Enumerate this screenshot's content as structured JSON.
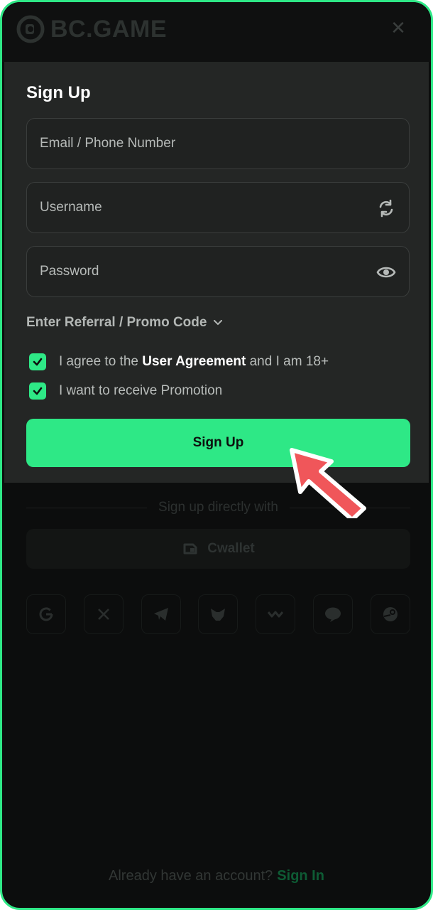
{
  "brand": {
    "name": "BC.GAME",
    "accent": "#2ee886"
  },
  "header": {
    "close_icon": "close-icon"
  },
  "form": {
    "title": "Sign Up",
    "email_placeholder": "Email / Phone Number",
    "username_placeholder": "Username",
    "password_placeholder": "Password",
    "promo_label": "Enter Referral / Promo Code",
    "agree_prefix": "I agree to the ",
    "agree_link": "User Agreement",
    "agree_suffix": " and I am 18+",
    "promo_opt_in": "I want to receive Promotion",
    "agree_checked": true,
    "promo_checked": true,
    "submit_label": "Sign Up"
  },
  "alt_signup": {
    "divider_text": "Sign up directly with",
    "cwallet_label": "Cwallet",
    "providers": [
      "google",
      "x",
      "telegram",
      "metamask",
      "walletconnect",
      "line",
      "steam"
    ]
  },
  "footer": {
    "prompt": "Already have an account?",
    "link": "Sign In"
  }
}
